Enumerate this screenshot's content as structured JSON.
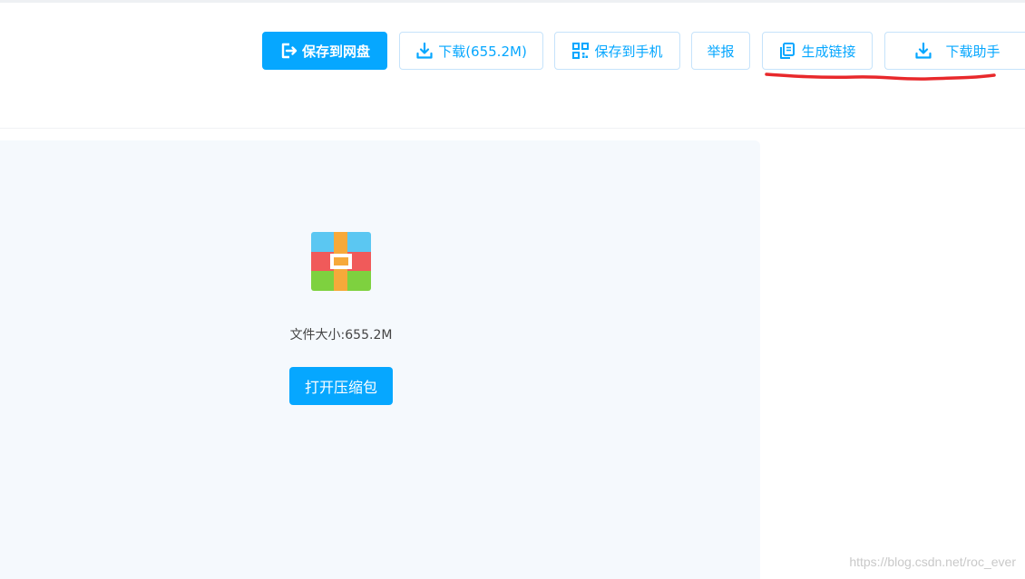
{
  "toolbar": {
    "save_to_netdisk": "保存到网盘",
    "download": "下载(655.2M)",
    "save_to_phone": "保存到手机",
    "report": "举报",
    "generate_link": "生成链接",
    "download_helper": "下载助手"
  },
  "file": {
    "size_label": "文件大小:655.2M",
    "open_archive": "打开压缩包"
  },
  "watermark": "https://blog.csdn.net/roc_ever",
  "colors": {
    "accent": "#06a7ff",
    "panel_bg": "#f5f9fd",
    "annotation": "#e8282b"
  },
  "icons": {
    "save_to_netdisk": "export-icon",
    "download": "download-icon",
    "save_to_phone": "qrcode-icon",
    "generate_link": "copy-icon",
    "download_helper": "download-icon",
    "file": "archive-icon"
  }
}
